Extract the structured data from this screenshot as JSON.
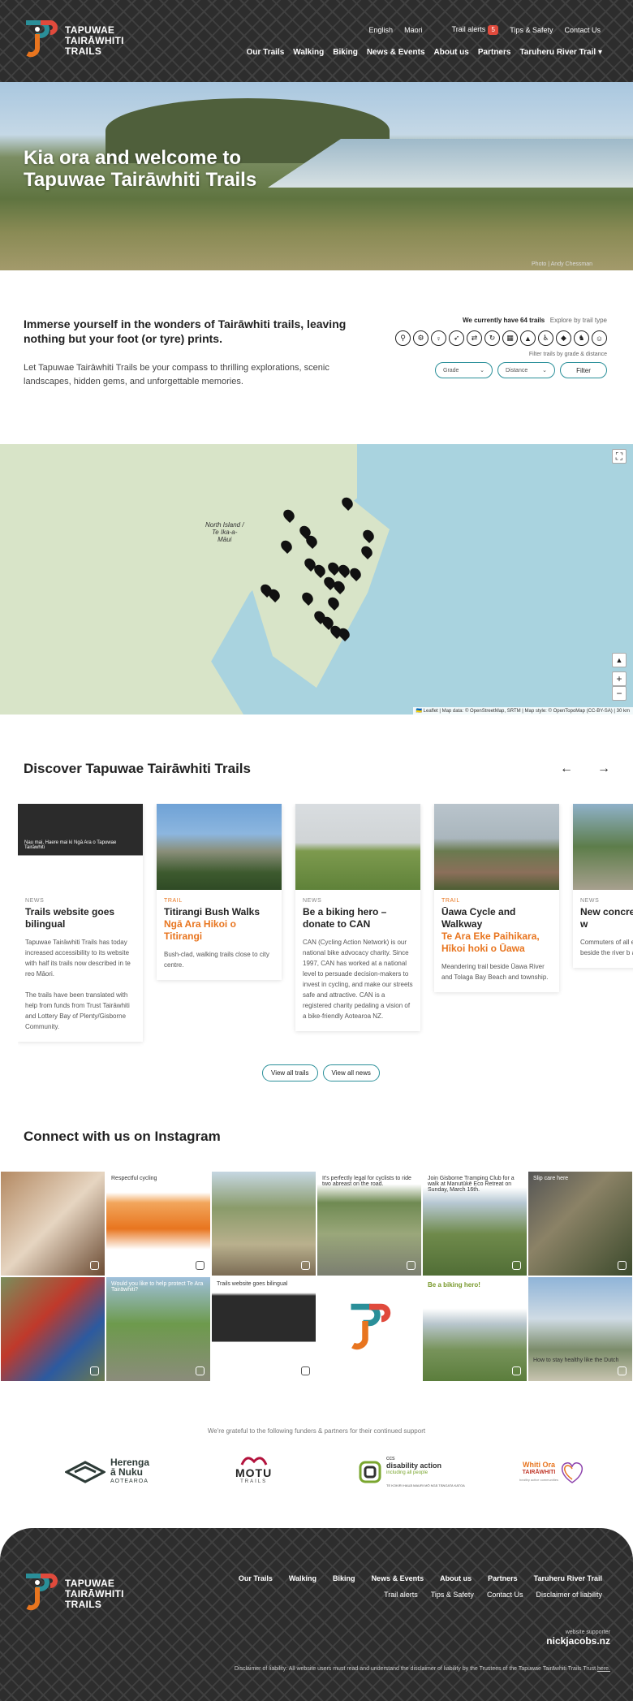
{
  "header": {
    "logo_line1": "TAPUWAE",
    "logo_line2": "TAIRĀWHITI",
    "logo_line3": "TRAILS",
    "lang_english": "English",
    "lang_maori": "Maori",
    "trail_alerts": "Trail alerts",
    "trail_alerts_count": "5",
    "tips_safety": "Tips & Safety",
    "contact_us": "Contact Us",
    "nav": [
      "Our Trails",
      "Walking",
      "Biking",
      "News & Events",
      "About us",
      "Partners",
      "Taruheru River Trail"
    ]
  },
  "hero": {
    "title_line1": "Kia ora and welcome to",
    "title_line2": "Tapuwae Tairāwhiti Trails",
    "credit": "Photo | Andy Chessman"
  },
  "intro": {
    "heading": "Immerse yourself in the wonders of Tairāwhiti trails, leaving nothing but your foot (or tyre) prints.",
    "body": "Let Tapuwae Tairāwhiti Trails be your compass to thrilling explorations, scenic landscapes, hidden gems, and unforgettable memories.",
    "trail_count": "We currently have 64 trails",
    "explore_type": "Explore by trail type",
    "filter_sub": "Filter trails by grade & distance",
    "grade_placeholder": "Grade",
    "distance_placeholder": "Distance",
    "filter_button": "Filter",
    "type_icons": [
      "cycle-icon",
      "mtb-icon",
      "walk-icon",
      "run-icon",
      "share-icon",
      "loop-icon",
      "city-icon",
      "hiker-icon",
      "accessible-icon",
      "dog-icon",
      "horse-icon",
      "family-icon"
    ]
  },
  "map": {
    "label_line1": "North Island /",
    "label_line2": "Te Ika-a-",
    "label_line3": "Māui",
    "attribution": "🇺🇦 Leaflet | Map data: © OpenStreetMap, SRTM | Map style: © OpenTopoMap (CC-BY-SA)",
    "scale": "30 km",
    "zoom_in": "+",
    "zoom_out": "−"
  },
  "discover": {
    "title": "Discover Tapuwae Tairāwhiti Trails",
    "cards": [
      {
        "type": "NEWS",
        "title": "Trails website goes bilingual",
        "alt": "",
        "body": "Tapuwae Tairāwhiti Trails has today increased accessibility to its website with half its trails now described in te reo Māori.\n\nThe trails have been translated with help from funds from Trust Tairāwhiti and Lottery Bay of Plenty/Gisborne Community.",
        "img_caption": "Nau mai, Haere mai ki Ngā Ara o Tapuwae Tairāwhiti"
      },
      {
        "type": "TRAIL",
        "title": "Titirangi Bush Walks",
        "alt": "Ngā Ara Hikoi o Titirangi",
        "body": "Bush-clad, walking trails close to city centre.",
        "img_caption": ""
      },
      {
        "type": "NEWS",
        "title": "Be a biking hero – donate to CAN",
        "alt": "",
        "body": "CAN (Cycling Action Network) is our national bike advocacy charity. Since 1997, CAN has worked at a national level to persuade decision-makers to invest in cycling, and make our streets safe and attractive. CAN is a registered charity pedaling a vision of a bike-friendly Aotearoa NZ.",
        "img_caption": ""
      },
      {
        "type": "TRAIL",
        "title": "Ūawa Cycle and Walkway",
        "alt": "Te Ara Eke Paihikara, Hīkoi hoki o Ūawa",
        "body": "Meandering trail beside Ūawa River and Tolaga Bay Beach and township.",
        "img_caption": ""
      },
      {
        "type": "NEWS",
        "title": "New concre lights the w",
        "alt": "",
        "body": "Commuters of all enjoying the new c beside the river b and Derby Street",
        "img_caption": ""
      }
    ],
    "view_trails": "View all trails",
    "view_news": "View all news"
  },
  "instagram": {
    "title": "Connect with us on Instagram",
    "tiles": [
      {
        "caption": ""
      },
      {
        "caption": "Respectful cycling"
      },
      {
        "caption": ""
      },
      {
        "caption": "It's perfectly legal for cyclists to ride two abreast on the road."
      },
      {
        "caption": "Join Gisborne Tramping Club for a walk at Manutūkē Eco Retreat on Sunday, March 16th."
      },
      {
        "caption": "Slip care here"
      },
      {
        "caption": ""
      },
      {
        "caption": "Would you like to help protect Te Ara Tairāwhiti?"
      },
      {
        "caption": "Trails website goes bilingual"
      },
      {
        "caption": ""
      },
      {
        "caption": "Be a biking hero!"
      },
      {
        "caption": "How to stay healthy like the Dutch"
      }
    ]
  },
  "partners": {
    "note": "We're grateful to the following funders & partners for their continued support",
    "herenga_line1": "Herenga",
    "herenga_line2": "ā Nuku",
    "herenga_line3": "AOTEAROA",
    "motu_line1": "MOTU",
    "motu_line2": "TRAILS",
    "disability_line1": "ccs",
    "disability_line2": "disability action",
    "disability_line3": "including all people",
    "disability_line4": "TE KOKIRI HAUĀ MAURI MŌ NGĀ TĀNGATA KATOA",
    "whiti_line1": "Whiti Ora",
    "whiti_line2": "TAIRĀWHITI",
    "whiti_line3": "healthy active communities"
  },
  "footer": {
    "nav": [
      "Our Trails",
      "Walking",
      "Biking",
      "News & Events",
      "About us",
      "Partners",
      "Taruheru River Trail"
    ],
    "nav2": [
      "Trail alerts",
      "Tips & Safety",
      "Contact Us",
      "Disclaimer of liability"
    ],
    "supporter_label": "website supporter",
    "supporter_name": "nickjacobs.nz",
    "disclaimer": "Disclaimer of liability: All website users must read and understand the disclaimer of liability by the Trustees of the Tapuwae Tairāwhiti Trails Trust",
    "disclaimer_link": "here."
  },
  "colors": {
    "dark": "#2d2d2d",
    "teal": "#2a8f99",
    "orange": "#e8751f",
    "alert": "#e04a3c"
  }
}
